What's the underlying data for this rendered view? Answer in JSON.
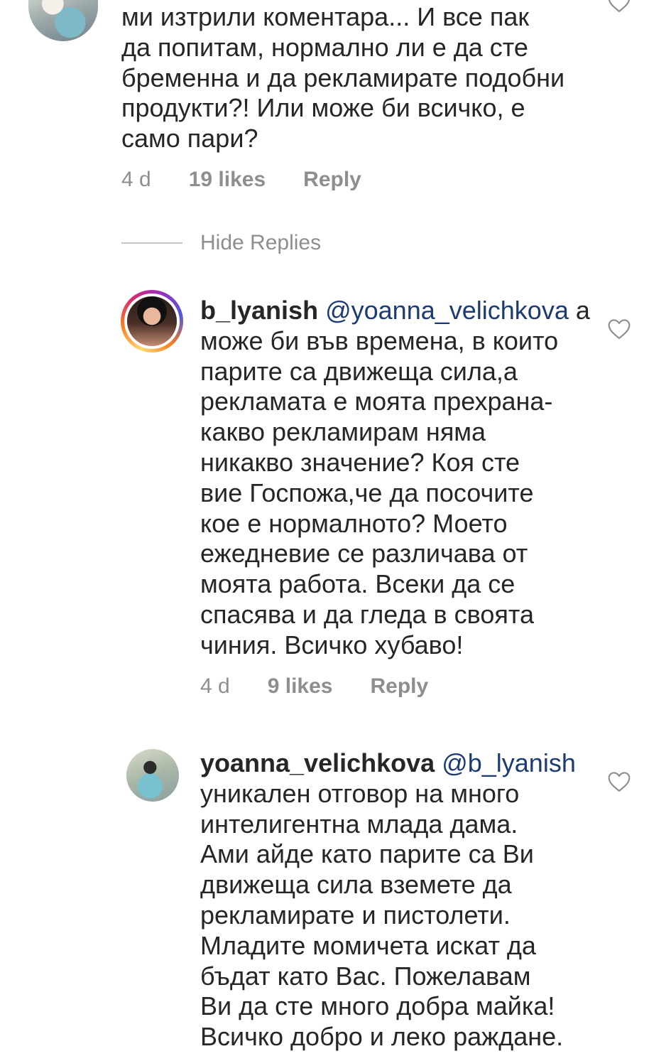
{
  "comments": [
    {
      "text": "ми изтрили коментара... И все пак\nда попитам, нормално ли е да сте\nбременна и да рекламирате подобни\nпродукти?! Или може би всичко, е\nсамо пари?",
      "time": "4 d",
      "likes": "19 likes",
      "reply": "Reply"
    }
  ],
  "hide_replies": "Hide Replies",
  "replies": [
    {
      "username": "b_lyanish",
      "mention": "@yoanna_velichkova",
      "text_first_line_tail": " а",
      "text": "може би във времена, в които\nпарите са движеща сила,а\nрекламата е моята прехрана-\nкакво рекламирам няма\nникакво значение? Коя сте\nвие Госпожа,че да посочите\nкое е нормалното? Моето\nежедневие се различава от\nмоята работа. Всеки да се\nспасява и да гледа в своята\nчиния. Всичко хубаво!",
      "time": "4 d",
      "likes": "9 likes",
      "reply": "Reply"
    },
    {
      "username": "yoanna_velichkova",
      "mention": "@b_lyanish",
      "text": "уникален отговор на много\nинтелигентна млада дама.\nАми айде като парите са Ви\nдвижеща сила вземете да\nрекламирате и пистолети.\nМладите момичета искат да\nбъдат като Вас. Пожелавам\nВи да сте много добра майка!\nВсичко добро и леко раждане."
    }
  ],
  "icons": {
    "like": "heart-outline-icon"
  }
}
